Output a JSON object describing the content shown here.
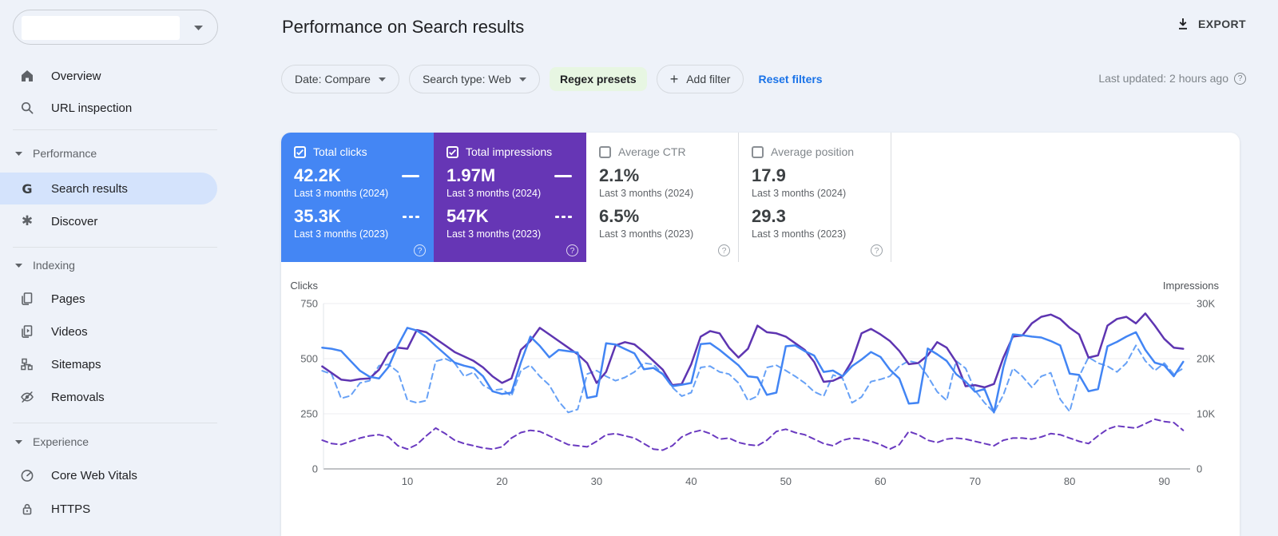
{
  "header": {
    "title": "Performance on Search results",
    "export_label": "EXPORT",
    "last_updated": "Last updated: 2 hours ago"
  },
  "property_selector": {
    "value": ""
  },
  "filters": {
    "date": "Date: Compare",
    "search_type": "Search type: Web",
    "regex_chip": "Regex presets",
    "add_filter": "Add filter",
    "reset": "Reset filters"
  },
  "sidebar": {
    "sections": [
      {
        "label": "Performance"
      },
      {
        "label": "Indexing"
      },
      {
        "label": "Experience"
      }
    ],
    "items": [
      {
        "label": "Overview"
      },
      {
        "label": "URL inspection"
      },
      {
        "label": "Search results"
      },
      {
        "label": "Discover"
      },
      {
        "label": "Pages"
      },
      {
        "label": "Videos"
      },
      {
        "label": "Sitemaps"
      },
      {
        "label": "Removals"
      },
      {
        "label": "Core Web Vitals"
      },
      {
        "label": "HTTPS"
      }
    ]
  },
  "cards": [
    {
      "label": "Total clicks",
      "checked": true,
      "color": "#4486f4",
      "rows": [
        {
          "value": "42.2K",
          "period": "Last 3 months (2024)"
        },
        {
          "value": "35.3K",
          "period": "Last 3 months (2023)"
        }
      ]
    },
    {
      "label": "Total impressions",
      "checked": true,
      "color": "#6636b5",
      "rows": [
        {
          "value": "1.97M",
          "period": "Last 3 months (2024)"
        },
        {
          "value": "547K",
          "period": "Last 3 months (2023)"
        }
      ]
    },
    {
      "label": "Average CTR",
      "checked": false,
      "rows": [
        {
          "value": "2.1%",
          "period": "Last 3 months (2024)"
        },
        {
          "value": "6.5%",
          "period": "Last 3 months (2023)"
        }
      ]
    },
    {
      "label": "Average position",
      "checked": false,
      "rows": [
        {
          "value": "17.9",
          "period": "Last 3 months (2024)"
        },
        {
          "value": "29.3",
          "period": "Last 3 months (2023)"
        }
      ]
    }
  ],
  "chart_data": {
    "type": "line",
    "x": {
      "ticks": [
        10,
        20,
        30,
        40,
        50,
        60,
        70,
        80,
        90
      ],
      "days": 92
    },
    "y_left": {
      "label": "Clicks",
      "max": 750,
      "ticks": [
        750,
        500,
        250,
        0
      ]
    },
    "y_right": {
      "label": "Impressions",
      "max": 30,
      "ticks": [
        "30K",
        "20K",
        "10K",
        "0"
      ],
      "tick_values": [
        30,
        20,
        10,
        0
      ]
    },
    "grid": true,
    "series": [
      {
        "name": "Impressions (2023)",
        "axis": "right",
        "style": "dashed",
        "color": "#6a3ac0",
        "unit": "K",
        "values": [
          5.2,
          4.6,
          4.4,
          5.0,
          5.6,
          6.0,
          6.2,
          5.8,
          4.2,
          3.6,
          4.4,
          6.0,
          7.4,
          6.4,
          5.2,
          4.6,
          4.2,
          3.8,
          3.6,
          4.0,
          5.6,
          6.6,
          7.0,
          6.8,
          6.0,
          5.2,
          4.4,
          4.2,
          4.0,
          5.0,
          6.2,
          6.4,
          6.0,
          5.6,
          4.6,
          3.6,
          3.4,
          4.2,
          5.8,
          6.6,
          7.0,
          6.4,
          5.4,
          5.6,
          4.8,
          4.4,
          4.2,
          5.2,
          6.8,
          7.2,
          6.6,
          6.2,
          5.4,
          4.6,
          4.2,
          5.2,
          5.6,
          5.4,
          5.0,
          4.4,
          3.6,
          4.4,
          6.8,
          6.2,
          5.2,
          4.8,
          5.4,
          5.6,
          5.4,
          5.0,
          4.6,
          4.2,
          5.2,
          5.6,
          5.6,
          5.4,
          5.8,
          6.4,
          6.2,
          5.6,
          5.0,
          4.6,
          6.0,
          7.2,
          7.8,
          7.6,
          7.4,
          8.2,
          9.0,
          8.6,
          8.4,
          7.0
        ]
      },
      {
        "name": "Clicks (2023)",
        "axis": "left",
        "style": "dashed",
        "color": "#67a1f6",
        "values": [
          445,
          430,
          320,
          332,
          390,
          400,
          468,
          474,
          440,
          312,
          300,
          310,
          488,
          500,
          480,
          420,
          438,
          380,
          356,
          362,
          330,
          446,
          470,
          420,
          380,
          306,
          256,
          270,
          430,
          446,
          420,
          400,
          415,
          440,
          480,
          474,
          430,
          370,
          330,
          346,
          460,
          466,
          440,
          430,
          390,
          310,
          330,
          460,
          470,
          446,
          420,
          390,
          350,
          330,
          426,
          410,
          300,
          326,
          396,
          406,
          420,
          466,
          490,
          480,
          420,
          350,
          310,
          490,
          456,
          356,
          300,
          256,
          336,
          456,
          420,
          370,
          420,
          436,
          316,
          260,
          420,
          506,
          480,
          466,
          440,
          480,
          560,
          490,
          446,
          480,
          430,
          456
        ]
      },
      {
        "name": "Impressions (2024)",
        "axis": "right",
        "style": "solid",
        "color": "#5e35b1",
        "unit": "K",
        "values": [
          18.6,
          17.4,
          16.2,
          16.0,
          16.3,
          16.4,
          18.0,
          21.0,
          22.0,
          21.8,
          25.2,
          24.8,
          23.6,
          22.4,
          21.2,
          20.4,
          19.6,
          18.4,
          16.8,
          15.6,
          16.4,
          21.6,
          23.2,
          25.6,
          24.4,
          23.2,
          22.0,
          20.8,
          19.2,
          15.6,
          17.6,
          22.4,
          23.0,
          22.6,
          21.2,
          19.6,
          18.0,
          15.2,
          15.4,
          19.0,
          24.0,
          25.0,
          24.6,
          22.0,
          20.2,
          21.8,
          26.0,
          24.8,
          24.6,
          24.0,
          22.8,
          21.6,
          19.4,
          15.8,
          16.0,
          16.8,
          19.6,
          24.6,
          25.4,
          24.4,
          23.2,
          21.4,
          19.0,
          19.2,
          20.6,
          23.0,
          22.0,
          19.4,
          15.0,
          15.2,
          14.8,
          15.4,
          20.2,
          24.0,
          24.2,
          26.4,
          27.6,
          28.0,
          27.2,
          25.6,
          24.4,
          20.2,
          20.6,
          26.0,
          27.2,
          27.6,
          26.4,
          28.2,
          26.0,
          23.6,
          22.0,
          21.8
        ]
      },
      {
        "name": "Clicks (2024)",
        "axis": "left",
        "style": "solid",
        "color": "#4285f4",
        "values": [
          550,
          545,
          535,
          490,
          445,
          418,
          410,
          462,
          560,
          640,
          628,
          598,
          558,
          520,
          482,
          468,
          458,
          420,
          352,
          340,
          346,
          482,
          600,
          558,
          506,
          540,
          534,
          528,
          322,
          330,
          570,
          564,
          544,
          524,
          452,
          458,
          430,
          375,
          382,
          390,
          566,
          570,
          540,
          505,
          470,
          420,
          415,
          336,
          346,
          556,
          560,
          534,
          514,
          440,
          446,
          420,
          466,
          496,
          530,
          508,
          450,
          410,
          296,
          300,
          546,
          520,
          490,
          430,
          396,
          350,
          362,
          256,
          462,
          610,
          606,
          600,
          596,
          580,
          560,
          432,
          426,
          352,
          362,
          556,
          576,
          600,
          620,
          540,
          482,
          470,
          420,
          486
        ]
      }
    ]
  }
}
